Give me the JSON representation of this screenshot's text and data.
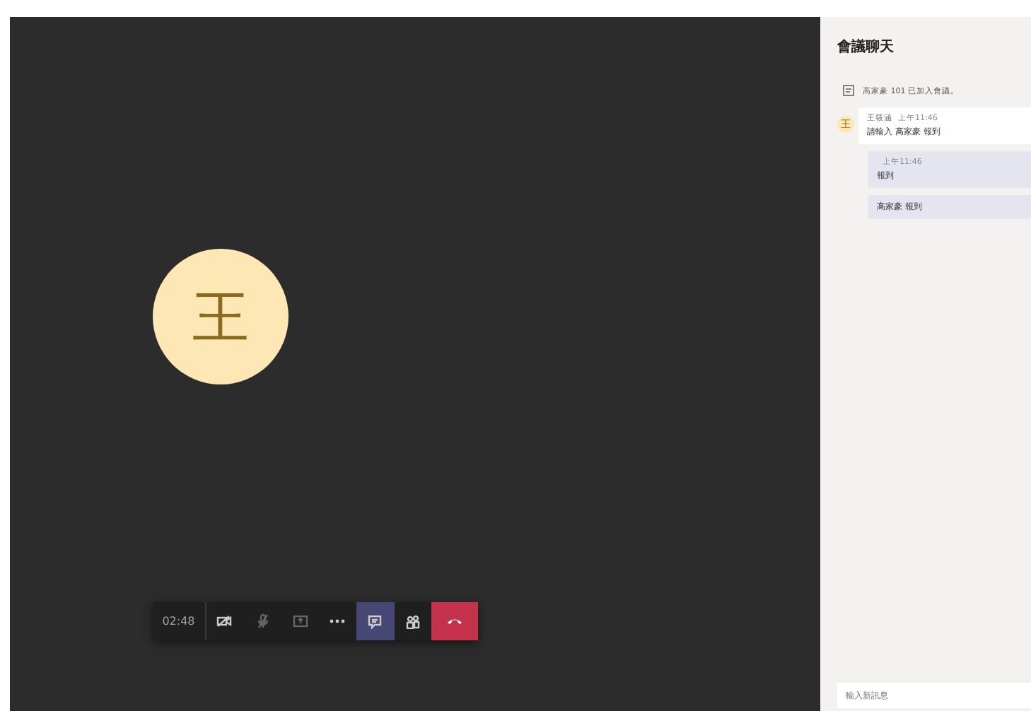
{
  "call": {
    "avatar": "王",
    "timer": "02:48",
    "controls": [
      {
        "kind": "camera",
        "selected": false
      },
      {
        "kind": "mic",
        "selected": false
      },
      {
        "kind": "share",
        "selected": false
      },
      {
        "kind": "more",
        "selected": false
      },
      {
        "kind": "chat",
        "selected": true
      },
      {
        "kind": "people",
        "selected": false
      },
      {
        "kind": "hangup",
        "selected": false
      }
    ]
  },
  "chat": {
    "title": "會議聊天",
    "notice": "高家豪 101 已加入會議。",
    "messages": [
      {
        "kind": "incoming",
        "avatar": "王",
        "sender": "王筱涵",
        "time": "上午11:46",
        "text": "請輸入 高家豪 報到"
      },
      {
        "kind": "outgoing",
        "time": "上午11:46",
        "text": "報到"
      },
      {
        "kind": "outgoing",
        "text": "高家豪 報到"
      }
    ],
    "input": {
      "placeholder": "輸入新訊息"
    }
  }
}
